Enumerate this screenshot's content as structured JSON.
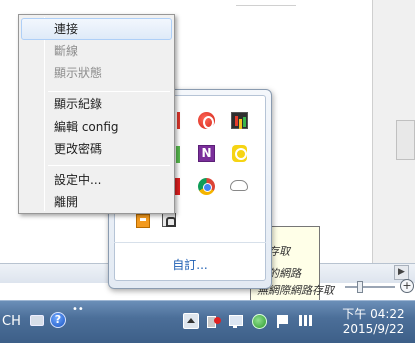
{
  "context_menu": {
    "items": [
      {
        "label": "連接",
        "enabled": true,
        "highlighted": true
      },
      {
        "label": "斷線",
        "enabled": false
      },
      {
        "label": "顯示狀態",
        "enabled": false
      },
      {
        "label": "顯示紀錄",
        "enabled": true
      },
      {
        "label": "編輯 config",
        "enabled": true
      },
      {
        "label": "更改密碼",
        "enabled": true
      },
      {
        "label": "設定中...",
        "enabled": true
      },
      {
        "label": "離開",
        "enabled": true
      }
    ]
  },
  "tray_panel": {
    "customize_label": "自訂...",
    "onenote_letter": "N",
    "icons": [
      "red-partial-icon",
      "opera-icon",
      "chart-icon",
      "green-partial-icon",
      "onenote-icon",
      "yellow-app-icon",
      "red-partial-icon",
      "chrome-icon",
      "cloud-icon",
      "orange-box-icon",
      "lock-icon"
    ]
  },
  "balloon": {
    "line1": "路存取",
    "line2": "據的網路",
    "line3": "無網際網路存取"
  },
  "taskbar": {
    "language": "CH",
    "help_glyph": "?",
    "mini_glyph": "••",
    "clock_time": "下午 04:22",
    "clock_date": "2015/9/22"
  },
  "statusbar": {
    "scroll_glyph": "▶",
    "zoom_glyph": "+"
  },
  "colors": {
    "taskbar": "#4c6f99",
    "menu_bg": "#f0f0f0",
    "link": "#1f5fb3",
    "menu_highlight": "#dfeaf8"
  }
}
